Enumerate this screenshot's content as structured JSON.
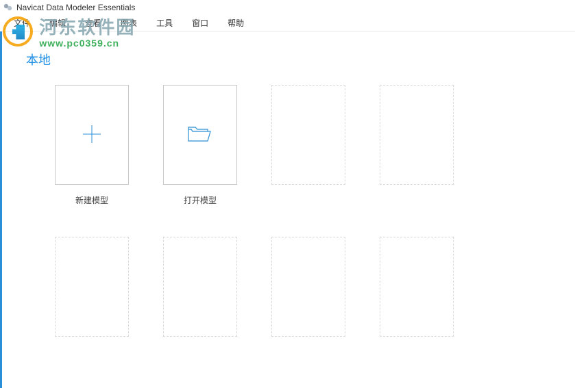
{
  "titlebar": {
    "title": "Navicat Data Modeler Essentials"
  },
  "menubar": {
    "items": [
      "文件",
      "编辑",
      "查看",
      "图表",
      "工具",
      "窗口",
      "帮助"
    ]
  },
  "section": {
    "title": "本地"
  },
  "tiles": [
    {
      "type": "solid",
      "icon": "plus",
      "label": "新建模型"
    },
    {
      "type": "solid",
      "icon": "folder",
      "label": "打开模型"
    },
    {
      "type": "dashed",
      "icon": "",
      "label": ""
    },
    {
      "type": "dashed",
      "icon": "",
      "label": ""
    },
    {
      "type": "dashed",
      "icon": "",
      "label": ""
    },
    {
      "type": "dashed",
      "icon": "",
      "label": ""
    },
    {
      "type": "dashed",
      "icon": "",
      "label": ""
    },
    {
      "type": "dashed",
      "icon": "",
      "label": ""
    }
  ],
  "watermark": {
    "cn": "河东软件园",
    "url": "www.pc0359.cn"
  }
}
